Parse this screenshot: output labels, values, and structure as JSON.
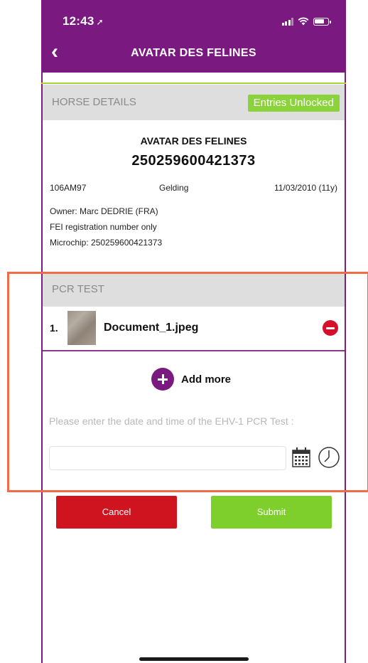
{
  "status_bar": {
    "time": "12:43",
    "location_glyph": "➚"
  },
  "nav": {
    "back_glyph": "‹",
    "title": "AVATAR DES FELINES"
  },
  "horse_details": {
    "section_title": "HORSE DETAILS",
    "badge": "Entries Unlocked",
    "name": "AVATAR DES FELINES",
    "id": "250259600421373",
    "code": "106AM97",
    "sex": "Gelding",
    "birth": "11/03/2010 (11y)",
    "owner": "Owner:  Marc DEDRIE (FRA)",
    "fei": "FEI registration number only",
    "microchip": "Microchip:  250259600421373"
  },
  "pcr_test": {
    "section_title": "PCR TEST",
    "documents": [
      {
        "number": "1.",
        "filename": "Document_1.jpeg"
      }
    ],
    "add_more_label": "Add more",
    "prompt": "Please enter the date and time of the EHV-1 PCR Test :",
    "date_value": "",
    "date_placeholder": ""
  },
  "actions": {
    "cancel": "Cancel",
    "submit": "Submit"
  },
  "colors": {
    "primary_purple": "#7a1a80",
    "accent_green": "#8ad33a",
    "danger_red": "#d0141f",
    "highlight_orange": "#ef6b4a"
  }
}
